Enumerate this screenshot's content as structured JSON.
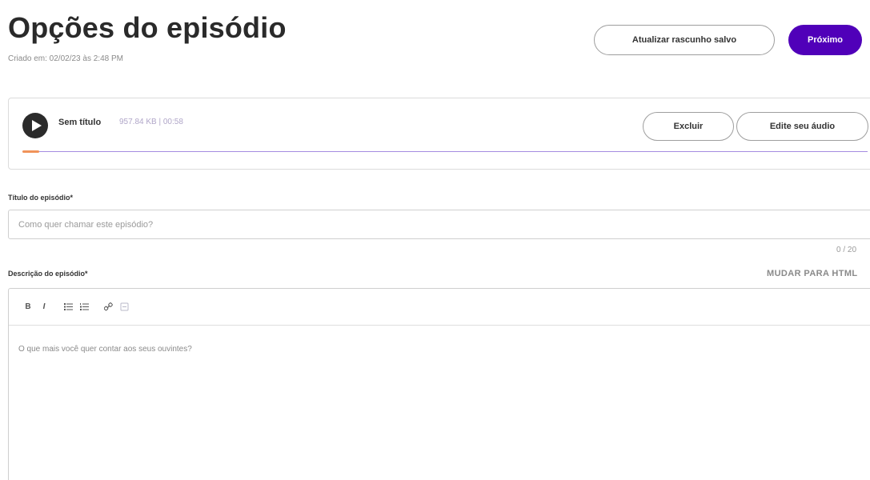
{
  "header": {
    "title": "Opções do episódio",
    "created_at": "Criado em: 02/02/23 às 2:48 PM",
    "update_draft_label": "Atualizar rascunho salvo",
    "next_label": "Próximo"
  },
  "audio": {
    "title": "Sem título",
    "meta": "957.84 KB | 00:58",
    "delete_label": "Excluir",
    "edit_label": "Edite seu áudio",
    "progress": 0.02,
    "colors": {
      "track": "#a58be0",
      "fill": "#f0935a"
    }
  },
  "episode_title": {
    "label": "Título do episódio*",
    "placeholder": "Como quer chamar este episódio?",
    "value": "",
    "char_count": "0 / 20"
  },
  "description": {
    "label": "Descrição do episódio*",
    "html_toggle_label": "MUDAR PARA HTML",
    "placeholder": "O que mais você quer contar aos seus ouvintes?",
    "toolbar": [
      {
        "name": "bold-icon",
        "glyph": "B"
      },
      {
        "name": "italic-icon",
        "glyph": "I"
      },
      {
        "name": "bulleted-list-icon",
        "glyph": "≔"
      },
      {
        "name": "numbered-list-icon",
        "glyph": "≔"
      },
      {
        "name": "link-icon",
        "glyph": "%"
      },
      {
        "name": "unlink-icon",
        "glyph": "⊟"
      }
    ]
  },
  "colors": {
    "brand": "#5000b9",
    "text": "#2a2a2a",
    "muted": "#8a8a8a"
  }
}
